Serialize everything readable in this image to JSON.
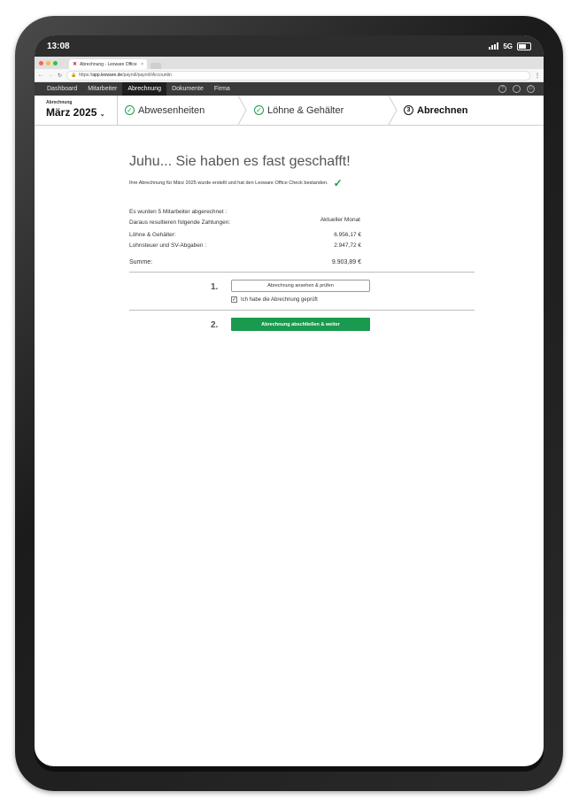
{
  "device": {
    "time": "13:08",
    "network": "5G"
  },
  "browser": {
    "tab_title": "Abrechnung - Lexware Office Lohn",
    "tab_close": "×",
    "url_prefix": "https://",
    "url_host": "app.lexware.de",
    "url_path": "/payroll/payroll/Accountin"
  },
  "nav": {
    "items": [
      "Dashboard",
      "Mitarbeiter",
      "Abrechnung",
      "Dokumente",
      "Firma"
    ],
    "active": "Abrechnung"
  },
  "period": {
    "label": "Abrechnung",
    "value": "März 2025"
  },
  "steps": [
    {
      "label": "Abwesenheiten",
      "status": "done"
    },
    {
      "label": "Löhne & Gehälter",
      "status": "done"
    },
    {
      "number": "3",
      "label": "Abrechnen",
      "status": "current"
    }
  ],
  "main": {
    "title": "Juhu... Sie haben es fast geschafft!",
    "subtitle": "Ihre Abrechnung für März 2025 wurde erstellt und hat den Lexware Office Check bestanden.",
    "employees_text": "Es wurden 5 Mitarbeiter abgerechnet :",
    "payments_text": "Daraus resultieren folgende Zahlungen:",
    "column_header": "Aktueller Monat",
    "rows": [
      {
        "label": "Löhne & Gehälter:",
        "value": "6.956,17 €"
      },
      {
        "label": "Lohnsteuer und SV-Abgaben :",
        "value": "2.947,72 €"
      }
    ],
    "sum": {
      "label": "Summe:",
      "value": "9.903,89 €"
    },
    "step1": {
      "number": "1.",
      "button": "Abrechnung ansehen & prüfen",
      "checkbox_label": "Ich habe die Abrechnung geprüft",
      "checked": true
    },
    "step2": {
      "number": "2.",
      "button": "Abrechnung abschließen & weiter"
    }
  },
  "colors": {
    "accent": "#1a9a4e",
    "nav_bg": "#3a3a3a"
  }
}
